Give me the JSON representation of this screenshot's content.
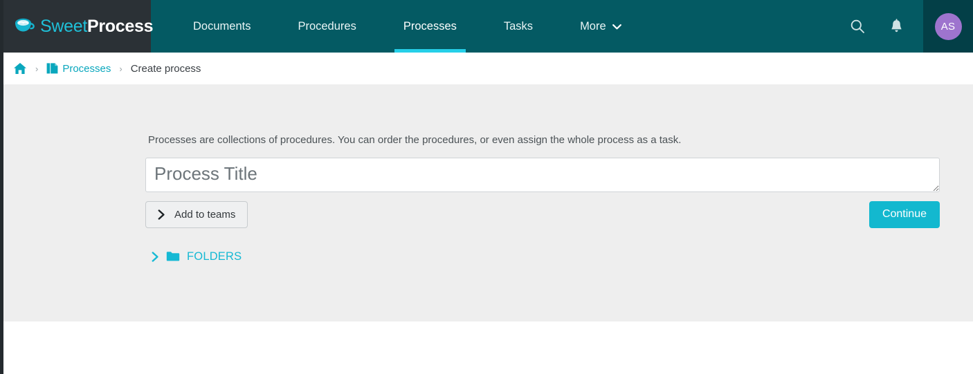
{
  "header": {
    "brand": {
      "icon": "coffee-cup-icon",
      "text_primary": "Sweet",
      "text_secondary": "Process"
    },
    "nav": [
      {
        "label": "Documents",
        "active": false
      },
      {
        "label": "Procedures",
        "active": false
      },
      {
        "label": "Processes",
        "active": true
      },
      {
        "label": "Tasks",
        "active": false
      },
      {
        "label": "More",
        "active": false,
        "caret": "⌄"
      }
    ],
    "actions": {
      "search_icon": "search-icon",
      "notifications_icon": "bell-icon"
    },
    "avatar": {
      "initials": "AS"
    },
    "colors": {
      "bar": "#045a63",
      "brand_panel": "#2b3136",
      "avatar_panel": "#033f47",
      "active_underline": "#25cfe8",
      "avatar_bg": "#9e74ce",
      "brand_accent": "#1fc0d8"
    }
  },
  "breadcrumb": {
    "home_icon": "home-icon",
    "separator": "›",
    "items": [
      {
        "label": "Processes",
        "icon": "documents-icon",
        "link": true
      },
      {
        "label": "Create process",
        "link": false
      }
    ]
  },
  "main": {
    "description": "Processes are collections of procedures. You can order the procedures, or even assign the whole process as a task.",
    "title_field": {
      "value": "",
      "placeholder": "Process Title"
    },
    "add_to_teams": {
      "label": "Add to teams",
      "chevron": "❯"
    },
    "continue": {
      "label": "Continue",
      "color": "#13b8cf"
    },
    "folders": {
      "label": "FOLDERS",
      "chevron": "❯",
      "icon": "folder-icon",
      "color": "#16b9d4"
    },
    "background": "#eeeeee"
  }
}
